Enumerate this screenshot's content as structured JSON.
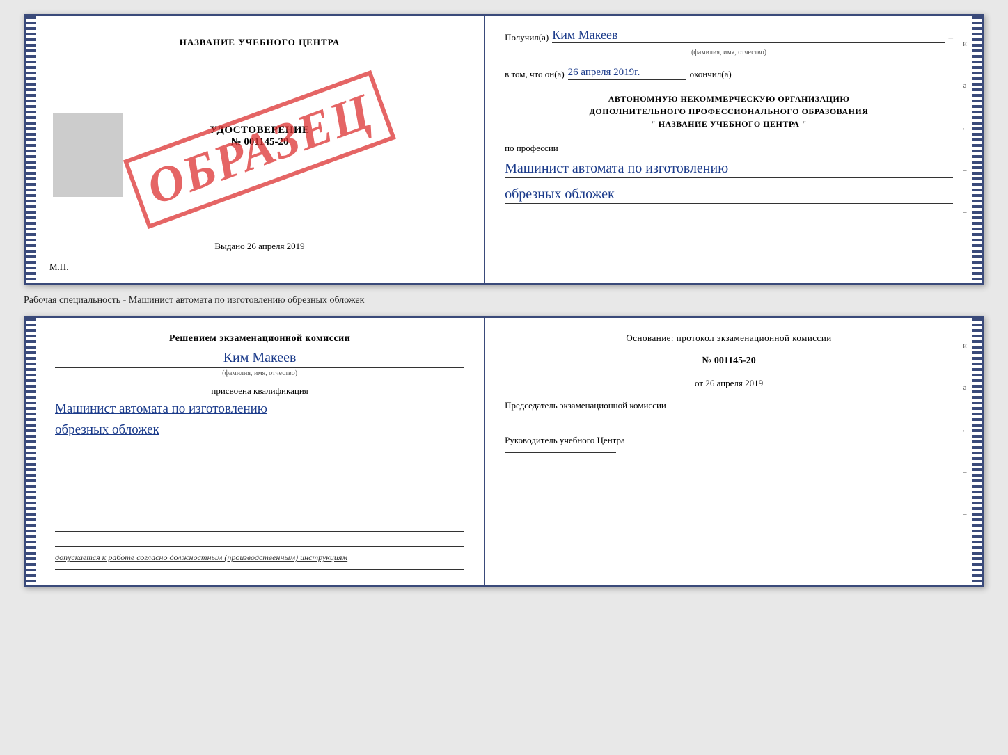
{
  "top_cert": {
    "left": {
      "title": "НАЗВАНИЕ УЧЕБНОГО ЦЕНТРА",
      "stamp": "ОБРАЗЕЦ",
      "udostoverenie": "УДОСТОВЕРЕНИЕ",
      "number": "№ 001145-20",
      "vudano_label": "Выдано",
      "vudano_date": "26 апреля 2019",
      "mp": "М.П."
    },
    "right": {
      "poluchil_label": "Получил(а)",
      "poluchil_value": "Ким Макеев",
      "poluchil_sub": "(фамилия, имя, отчество)",
      "vtom_label": "в том, что он(а)",
      "vtom_date": "26 апреля 2019г.",
      "okoncil_label": "окончил(а)",
      "org_line1": "АВТОНОМНУЮ НЕКОММЕРЧЕСКУЮ ОРГАНИЗАЦИЮ",
      "org_line2": "ДОПОЛНИТЕЛЬНОГО ПРОФЕССИОНАЛЬНОГО ОБРАЗОВАНИЯ",
      "org_line3": "\"  НАЗВАНИЕ УЧЕБНОГО ЦЕНТРА  \"",
      "po_professii": "по профессии",
      "profession1": "Машинист автомата по изготовлению",
      "profession2": "обрезных обложек",
      "edge_chars": [
        "и",
        "а",
        "←",
        "–",
        "–",
        "–"
      ]
    }
  },
  "middle_text": "Рабочая специальность - Машинист автомата по изготовлению обрезных обложек",
  "bottom_cert": {
    "left": {
      "title_line1": "Решением экзаменационной комиссии",
      "name": "Ким Макеев",
      "name_sub": "(фамилия, имя, отчество)",
      "prisvoena": "присвоена квалификация",
      "qualification1": "Машинист автомата по изготовлению",
      "qualification2": "обрезных обложек",
      "dopusk": "допускается к работе согласно должностным (производственным) инструкциям"
    },
    "right": {
      "basis_label": "Основание: протокол экзаменационной комиссии",
      "number": "№  001145-20",
      "ot_label": "от",
      "ot_date": "26 апреля 2019",
      "predsedatel_label": "Председатель экзаменационной комиссии",
      "rukovoditel_label": "Руководитель учебного Центра",
      "edge_chars": [
        "и",
        "а",
        "←",
        "–",
        "–",
        "–"
      ]
    }
  }
}
